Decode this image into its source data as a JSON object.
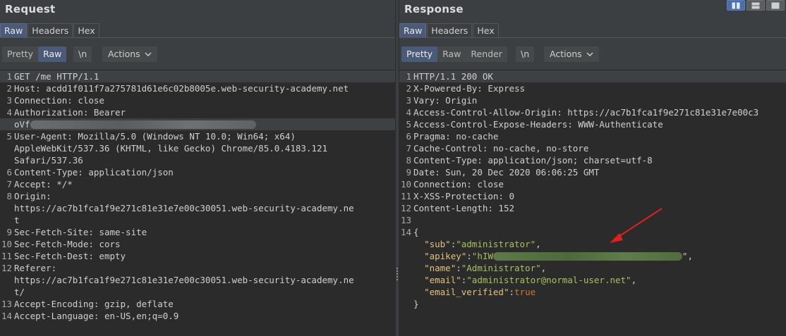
{
  "request": {
    "title": "Request",
    "tabs": [
      {
        "label": "Raw",
        "active": true
      },
      {
        "label": "Headers",
        "active": false
      },
      {
        "label": "Hex",
        "active": false
      }
    ],
    "toolbar": {
      "view_buttons": [
        {
          "label": "Pretty",
          "active": false
        },
        {
          "label": "Raw",
          "active": true
        }
      ],
      "newline_label": "\\n",
      "actions_label": "Actions"
    },
    "lines": [
      {
        "n": "1",
        "text": "GET /me HTTP/1.1"
      },
      {
        "n": "2",
        "key": "Host:",
        "value": " acdd1f011f7a275781d61e6c02b8005e.web-security-academy.net"
      },
      {
        "n": "3",
        "key": "Connection:",
        "value": " close"
      },
      {
        "n": "4",
        "key": "Authorization:",
        "value": " Bearer"
      },
      {
        "n": "",
        "value": "oVf",
        "redacted": true
      },
      {
        "n": "5",
        "key": "User-Agent:",
        "value": " Mozilla/5.0 (Windows NT 10.0; Win64; x64)"
      },
      {
        "n": "",
        "value": "AppleWebKit/537.36 (KHTML, like Gecko) Chrome/85.0.4183.121"
      },
      {
        "n": "",
        "value": "Safari/537.36"
      },
      {
        "n": "6",
        "key": "Content-Type:",
        "value": " application/json"
      },
      {
        "n": "7",
        "key": "Accept:",
        "value": " */*"
      },
      {
        "n": "8",
        "key": "Origin:"
      },
      {
        "n": "",
        "value": "https://ac7b1fca1f9e271c81e31e7e00c30051.web-security-academy.ne"
      },
      {
        "n": "",
        "value": "t"
      },
      {
        "n": "9",
        "key": "Sec-Fetch-Site:",
        "value": " same-site"
      },
      {
        "n": "10",
        "key": "Sec-Fetch-Mode:",
        "value": " cors"
      },
      {
        "n": "11",
        "key": "Sec-Fetch-Dest:",
        "value": " empty"
      },
      {
        "n": "12",
        "key": "Referer:"
      },
      {
        "n": "",
        "value": "https://ac7b1fca1f9e271c81e31e7e00c30051.web-security-academy.ne"
      },
      {
        "n": "",
        "value": "t/"
      },
      {
        "n": "13",
        "key": "Accept-Encoding:",
        "value": " gzip, deflate"
      },
      {
        "n": "14",
        "key": "Accept-Language:",
        "value": " en-US,en;q=0.9"
      }
    ]
  },
  "response": {
    "title": "Response",
    "tabs": [
      {
        "label": "Raw",
        "active": true
      },
      {
        "label": "Headers",
        "active": false
      },
      {
        "label": "Hex",
        "active": false
      }
    ],
    "toolbar": {
      "view_buttons": [
        {
          "label": "Pretty",
          "active": true
        },
        {
          "label": "Raw",
          "active": false
        },
        {
          "label": "Render",
          "active": false
        }
      ],
      "newline_label": "\\n",
      "actions_label": "Actions"
    },
    "lines": [
      {
        "n": "1",
        "text": "HTTP/1.1 200 OK"
      },
      {
        "n": "2",
        "key": "X-Powered-By:",
        "value": " Express"
      },
      {
        "n": "3",
        "key": "Vary:",
        "value": " Origin"
      },
      {
        "n": "4",
        "key": "Access-Control-Allow-Origin:",
        "value": " https://ac7b1fca1f9e271c81e31e7e00c3"
      },
      {
        "n": "5",
        "key": "Access-Control-Expose-Headers:",
        "value": " WWW-Authenticate"
      },
      {
        "n": "6",
        "key": "Pragma:",
        "value": " no-cache"
      },
      {
        "n": "7",
        "key": "Cache-Control:",
        "value": " no-cache, no-store"
      },
      {
        "n": "8",
        "key": "Content-Type:",
        "value": " application/json; charset=utf-8"
      },
      {
        "n": "9",
        "key": "Date:",
        "value": " Sun, 20 Dec 2020 06:06:25 GMT"
      },
      {
        "n": "10",
        "key": "Connection:",
        "value": " close"
      },
      {
        "n": "11",
        "key": "X-XSS-Protection:",
        "value": " 0"
      },
      {
        "n": "12",
        "key": "Content-Length:",
        "value": " 152"
      },
      {
        "n": "13",
        "text": ""
      },
      {
        "n": "14",
        "text": "{"
      }
    ],
    "json_body": [
      {
        "key": "\"sub\"",
        "value": "\"administrator\"",
        "suffix": ","
      },
      {
        "key": "\"apikey\"",
        "value": "\"hIW",
        "redacted": true,
        "suffix": "\","
      },
      {
        "key": "\"name\"",
        "value": "\"Administrator\"",
        "suffix": ","
      },
      {
        "key": "\"email\"",
        "value": "\"administrator@normal-user.net\"",
        "suffix": ","
      },
      {
        "key": "\"email_verified\"",
        "value": "true",
        "bool": true,
        "suffix": ""
      }
    ],
    "closing": "}"
  },
  "layout_buttons": [
    {
      "name": "side-by-side",
      "active": true
    },
    {
      "name": "stacked",
      "active": false
    },
    {
      "name": "single",
      "active": false
    }
  ],
  "colors": {
    "background": "#3c3f41",
    "editor": "#2b2b2b",
    "active_tab": "#4b5a78",
    "json_key": "#e6c07b",
    "json_value": "#a5c25c",
    "json_bool": "#cc7832",
    "annotation_arrow": "#e02020"
  }
}
